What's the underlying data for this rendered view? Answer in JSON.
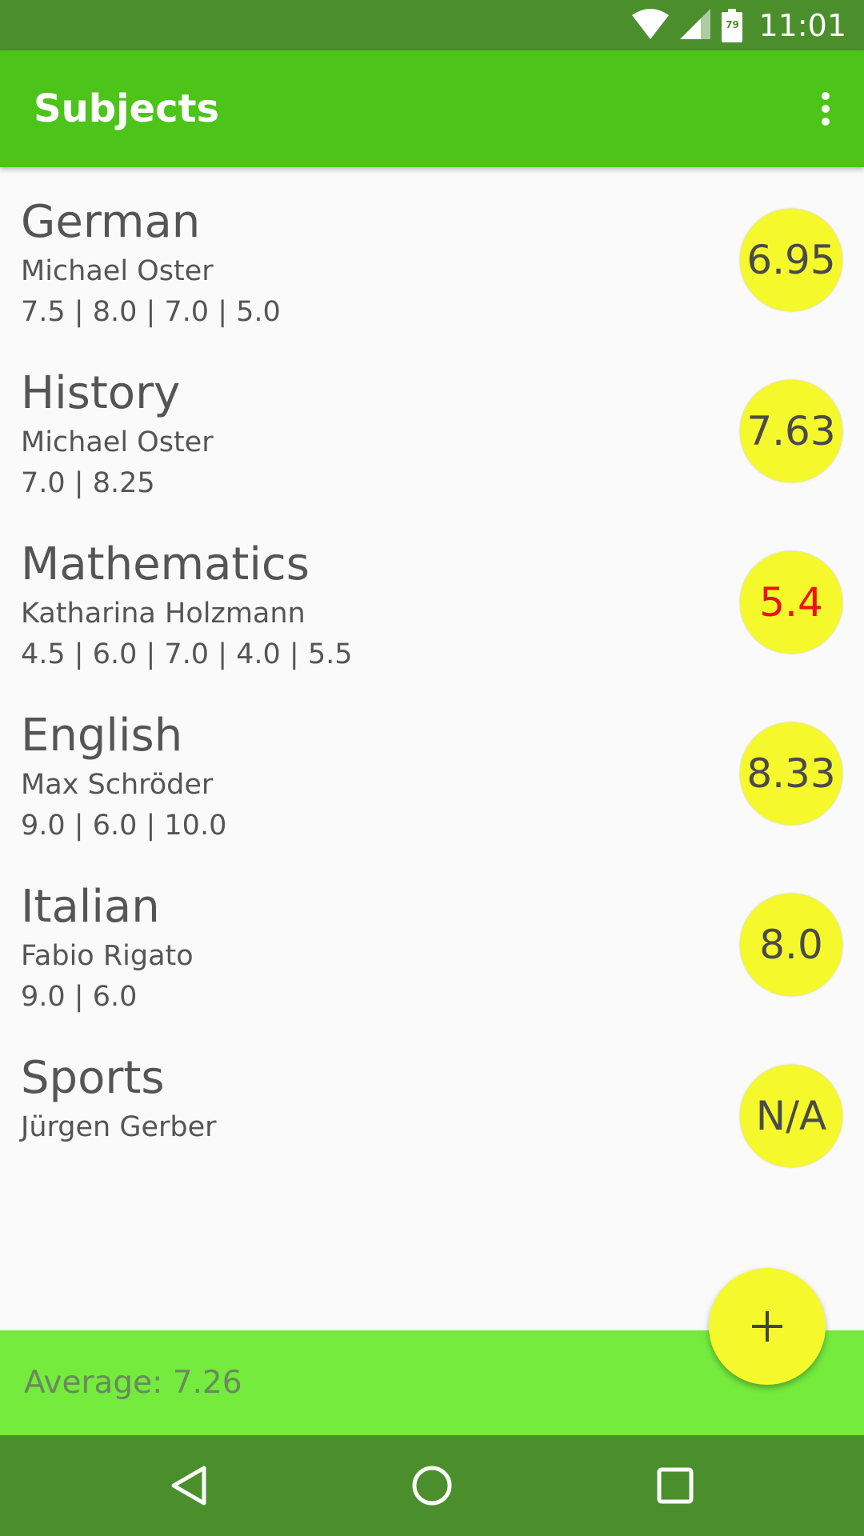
{
  "status_bar": {
    "time": "11:01",
    "battery_level": "79",
    "icons": [
      "wifi-icon",
      "cell-signal-icon",
      "battery-icon"
    ],
    "background_color": "#4a8f2b"
  },
  "app_bar": {
    "title": "Subjects",
    "menu_icon": "more-vert-icon",
    "background_color": "#4cc41a"
  },
  "subjects": [
    {
      "name": "German",
      "teacher": "Michael Oster",
      "grades": "7.5 | 8.0 | 7.0 | 5.0",
      "average": "6.95"
    },
    {
      "name": "History",
      "teacher": "Michael Oster",
      "grades": "7.0 | 8.25",
      "average": "7.63"
    },
    {
      "name": "Mathematics",
      "teacher": "Katharina Holzmann",
      "grades": "4.5 | 6.0 | 7.0 | 4.0 | 5.5",
      "average": "5.4",
      "average_color": "#ee1111"
    },
    {
      "name": "English",
      "teacher": "Max Schröder",
      "grades": "9.0 | 6.0 | 10.0",
      "average": "8.33"
    },
    {
      "name": "Italian",
      "teacher": "Fabio Rigato",
      "grades": "9.0 | 6.0",
      "average": "8.0"
    },
    {
      "name": "Sports",
      "teacher": "Jürgen Gerber",
      "grades": "",
      "average": "N/A"
    }
  ],
  "badge_color": "#f5f92b",
  "footer": {
    "average_label": "Average: 7.26",
    "background_color": "#74eb3d"
  },
  "fab": {
    "icon": "plus-icon",
    "color": "#f5f92b"
  },
  "nav_bar": {
    "icons": [
      "back-icon",
      "home-icon",
      "recents-icon"
    ],
    "background_color": "#4a8f2b"
  }
}
